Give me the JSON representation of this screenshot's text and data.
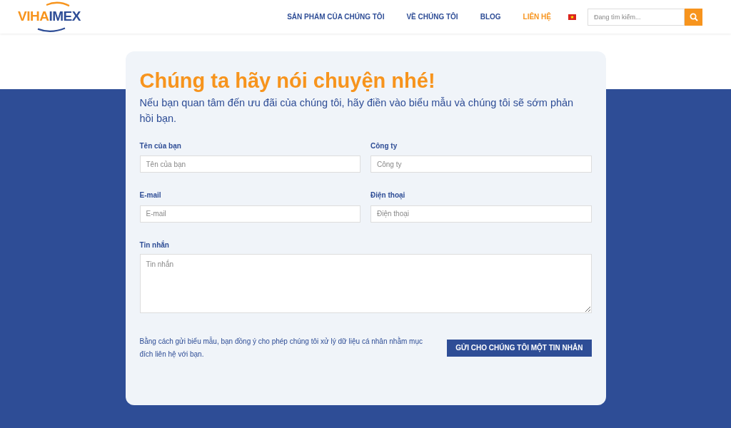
{
  "logo": {
    "part_1": "VIHA",
    "part_2": "IMEX"
  },
  "nav": [
    {
      "label": "SẢN PHẨM CỦA CHÚNG TÔI",
      "selected": false
    },
    {
      "label": "VỀ CHÚNG TÔI",
      "selected": false
    },
    {
      "label": "BLOG",
      "selected": false
    },
    {
      "label": "LIÊN HỆ",
      "selected": true
    }
  ],
  "search": {
    "placeholder": "Đang tìm kiếm..."
  },
  "form": {
    "title": "Chúng ta hãy nói chuyện nhé!",
    "intro": "Nếu bạn quan tâm đến ưu đãi của chúng tôi, hãy điền vào biểu mẫu và chúng tôi sẽ sớm phản hồi bạn.",
    "fields": [
      {
        "kind": "input",
        "label": "Tên của bạn",
        "placeholder": "Tên của bạn"
      },
      {
        "kind": "input",
        "label": "Công ty",
        "placeholder": "Công ty"
      },
      {
        "kind": "input",
        "label": "E-mail",
        "placeholder": "E-mail"
      },
      {
        "kind": "input",
        "label": "Điện thoại",
        "placeholder": "Điện thoại"
      },
      {
        "kind": "textarea",
        "label": "Tin nhắn",
        "placeholder": "Tin nhắn"
      }
    ],
    "consent": "Bằng cách gửi biểu mẫu, bạn đồng ý cho phép chúng tôi xử lý dữ liệu cá nhân nhằm mục đích liên hệ với bạn.",
    "submit": "GỬI CHO CHÚNG TÔI MỘT TIN NHẮN"
  }
}
